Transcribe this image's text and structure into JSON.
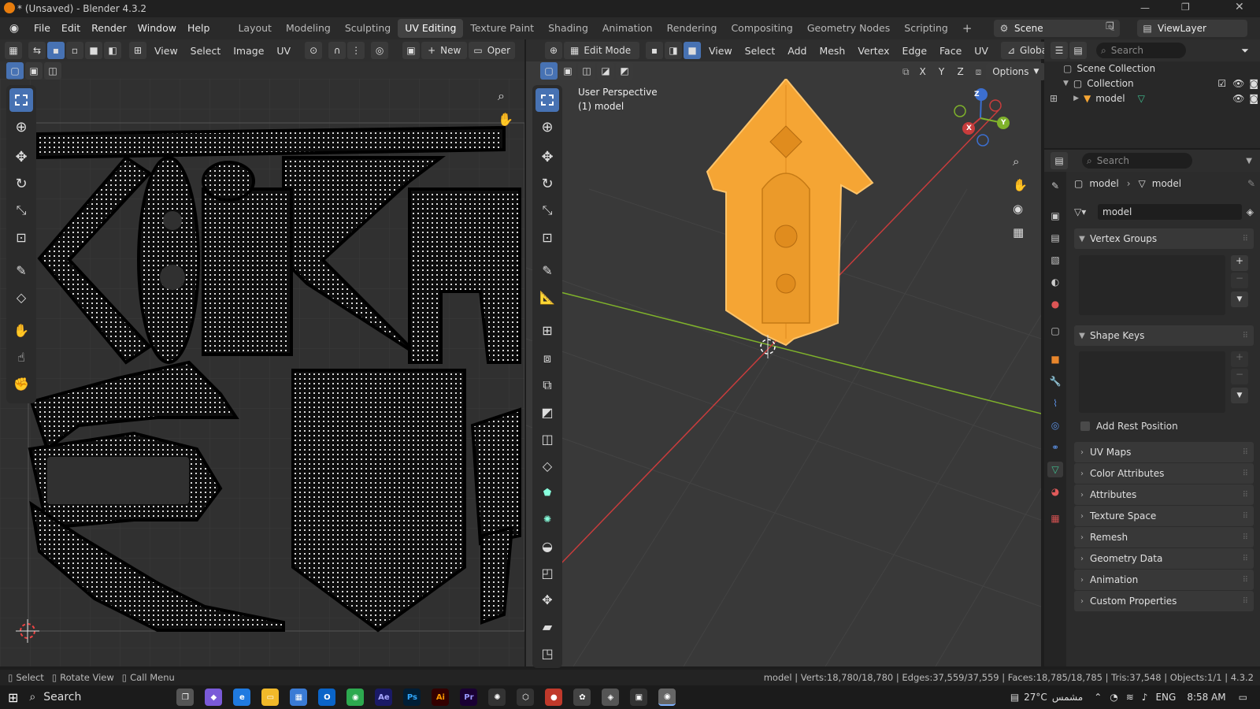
{
  "window": {
    "title": "* (Unsaved) - Blender 4.3.2"
  },
  "menus": [
    "File",
    "Edit",
    "Render",
    "Window",
    "Help"
  ],
  "workspaces": [
    "Layout",
    "Modeling",
    "Sculpting",
    "UV Editing",
    "Texture Paint",
    "Shading",
    "Animation",
    "Rendering",
    "Compositing",
    "Geometry Nodes",
    "Scripting"
  ],
  "active_workspace": "UV Editing",
  "scene": {
    "scene_label": "Scene",
    "viewlayer_label": "ViewLayer"
  },
  "uv_editor": {
    "menus": [
      "View",
      "Select",
      "Image",
      "UV"
    ],
    "new_label": "New",
    "open_label": "Oper"
  },
  "viewport": {
    "mode_label": "Edit Mode",
    "menus": [
      "View",
      "Select",
      "Add",
      "Mesh",
      "Vertex",
      "Edge",
      "Face",
      "UV"
    ],
    "transform_label": "Global",
    "options_label": "Options",
    "perspective_label": "User Perspective",
    "object_label": "(1) model",
    "axis": [
      "X",
      "Y",
      "Z"
    ]
  },
  "outliner": {
    "search_placeholder": "Search",
    "scene_collection": "Scene Collection",
    "collection": "Collection",
    "object": "model"
  },
  "properties": {
    "search_placeholder": "Search",
    "breadcrumb_object": "model",
    "breadcrumb_mesh": "model",
    "mesh_name": "model",
    "vertex_groups": "Vertex Groups",
    "shape_keys": "Shape Keys",
    "add_rest_position": "Add Rest Position",
    "sections": [
      "UV Maps",
      "Color Attributes",
      "Attributes",
      "Texture Space",
      "Remesh",
      "Geometry Data",
      "Animation",
      "Custom Properties"
    ]
  },
  "status": {
    "select": "Select",
    "rotate_view": "Rotate View",
    "call_menu": "Call Menu",
    "stats": "model | Verts:18,780/18,780 | Edges:37,559/37,559 | Faces:18,785/18,785 | Tris:37,548 | Objects:1/1 | 4.3.2"
  },
  "taskbar": {
    "search_label": "Search",
    "temperature": "27°C",
    "weather_text": "مشمس",
    "lang": "ENG",
    "time": "8:58 AM"
  },
  "colors": {
    "accent": "#4772b3",
    "mesh_orange": "#f5a534",
    "x_axis": "#c83c3c",
    "y_axis": "#7fb22b",
    "z_axis": "#3c6fd0"
  }
}
